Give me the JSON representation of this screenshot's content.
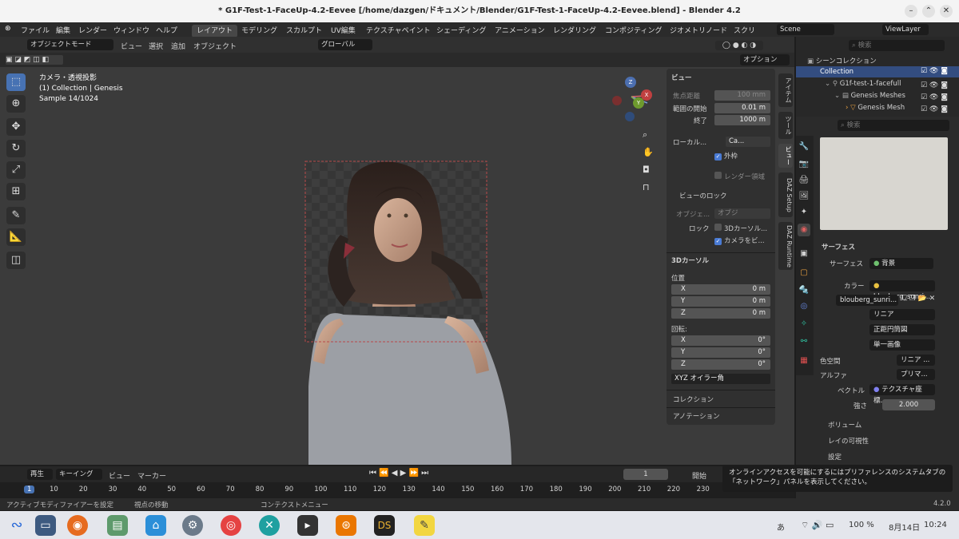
{
  "window": {
    "title": "* G1F-Test-1-FaceUp-4.2-Eevee [/home/dazgen/ドキュメント/Blender/G1F-Test-1-FaceUp-4.2-Eevee.blend] - Blender 4.2",
    "minimize": "–",
    "maximize": "⌃",
    "close": "✕"
  },
  "menu": {
    "file": "ファイル",
    "edit": "編集",
    "render": "レンダー",
    "window": "ウィンドウ",
    "help": "ヘルプ"
  },
  "workspaces": [
    "レイアウト",
    "モデリング",
    "スカルプト",
    "UV編集",
    "テクスチャペイント",
    "シェーディング",
    "アニメーション",
    "レンダリング",
    "コンポジティング",
    "ジオメトリノード",
    "スクリ"
  ],
  "scene": {
    "label": "Scene",
    "view_layer": "ViewLayer"
  },
  "viewport_header": {
    "mode": "オブジェクトモード",
    "view": "ビュー",
    "select": "選択",
    "add": "追加",
    "object": "オブジェクト",
    "orientation": "グローバル",
    "options": "オプション"
  },
  "overlay": {
    "line1": "カメラ・透視投影",
    "line2": "(1) Collection | Genesis",
    "line3": "Sample 14/1024"
  },
  "gizmo": {
    "x": "X",
    "y": "Y",
    "z": "Z"
  },
  "npanel": {
    "view_header": "ビュー",
    "focal_label": "焦点距離",
    "focal_value": "100 mm",
    "clip_start_label": "範囲の開始",
    "clip_start_value": "0.01 m",
    "clip_end_label": "終了",
    "clip_end_value": "1000 m",
    "local_label": "ローカル...",
    "local_camera": "Ca...",
    "outer_label": "外枠",
    "render_region_label": "レンダー領域",
    "lock_header": "ビューのロック",
    "lock_object_label": "オブジェ...",
    "lock_object_value": "オブジ",
    "lock_label": "ロック",
    "lock_3d_cursor": "3Dカーソル...",
    "lock_camera": "カメラをビ...",
    "cursor_header": "3Dカーソル",
    "location_label": "位置",
    "loc_x": "X",
    "loc_x_value": "0 m",
    "loc_y": "Y",
    "loc_y_value": "0 m",
    "loc_z": "Z",
    "loc_z_value": "0 m",
    "rotation_label": "回転:",
    "rot_x": "X",
    "rot_x_value": "0°",
    "rot_y": "Y",
    "rot_y_value": "0°",
    "rot_z": "Z",
    "rot_z_value": "0°",
    "rotation_mode": "XYZ オイラー角",
    "collection_header": "コレクション",
    "annotation_header": "アノテーション"
  },
  "vtabs": [
    "アイテム",
    "ツール",
    "ビュー",
    "DAZ Setup",
    "DAZ Runtime"
  ],
  "outliner": {
    "search_placeholder": "検索",
    "items": [
      {
        "label": "シーンコレクション"
      },
      {
        "label": "Collection"
      },
      {
        "label": "G1f-test-1-facefull"
      },
      {
        "label": "Genesis Meshes"
      },
      {
        "label": "Genesis Mesh"
      }
    ]
  },
  "properties": {
    "search_placeholder": "検索",
    "surface_header": "サーフェス",
    "surface_label": "サーフェス",
    "surface_value": "背景",
    "color_label": "カラー",
    "color_value": "blouberg_sunri...",
    "image_name": "blouberg_sunri...",
    "interp": "リニア",
    "projection": "正距円筒図",
    "source": "単一画像",
    "colorspace_label": "色空間",
    "colorspace_value": "リニア ...",
    "alpha_label": "アルファ",
    "alpha_value": "プリマ...",
    "vector_label": "ベクトル",
    "vector_value": "テクスチャ座標...",
    "strength_label": "強さ",
    "strength_value": "2.000",
    "volume_header": "ボリューム",
    "ray_visibility_header": "レイの可視性",
    "settings_header": "設定"
  },
  "timeline": {
    "playback": "再生",
    "keying": "キーイング",
    "view": "ビュー",
    "marker": "マーカー",
    "current_frame": "1",
    "start_label": "開始",
    "ticks": [
      "1",
      "10",
      "20",
      "30",
      "40",
      "50",
      "60",
      "70",
      "80",
      "90",
      "100",
      "110",
      "120",
      "130",
      "140",
      "150",
      "160",
      "170",
      "180",
      "190",
      "200",
      "210",
      "220",
      "230"
    ]
  },
  "tooltip": {
    "line1": "オンラインアクセスを可能にするにはプリファレンスのシステムタブの",
    "line2": "「ネットワーク」パネルを表示してください。"
  },
  "statusbar": {
    "item1": "アクティブモディファイアーを設定",
    "item2": "視点の移動",
    "item3": "コンテクストメニュー",
    "version": "4.2.0"
  },
  "taskbar": {
    "ime": "あ",
    "battery": "100 %",
    "date": "8月14日",
    "time": "10:24"
  }
}
